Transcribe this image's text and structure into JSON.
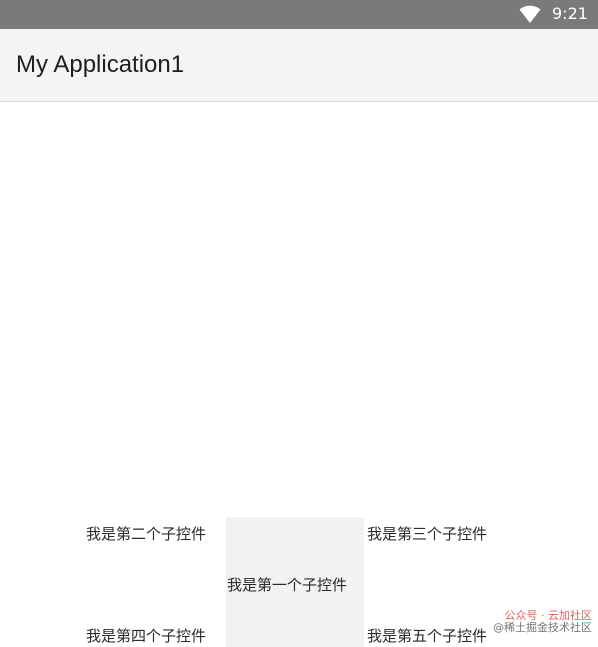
{
  "status_bar": {
    "time": "9:21",
    "wifi_icon": "wifi-icon",
    "background_color": "#7a7a7a"
  },
  "app_bar": {
    "title": "My Application1",
    "background_color": "#f4f4f4"
  },
  "children": {
    "first": "我是第一个子控件",
    "second": "我是第二个子控件",
    "third": "我是第三个子控件",
    "fourth": "我是第四个子控件",
    "fifth": "我是第五个子控件"
  },
  "watermark": {
    "line1": "公众号 · 云加社区",
    "line2": "@稀土掘金技术社区"
  }
}
